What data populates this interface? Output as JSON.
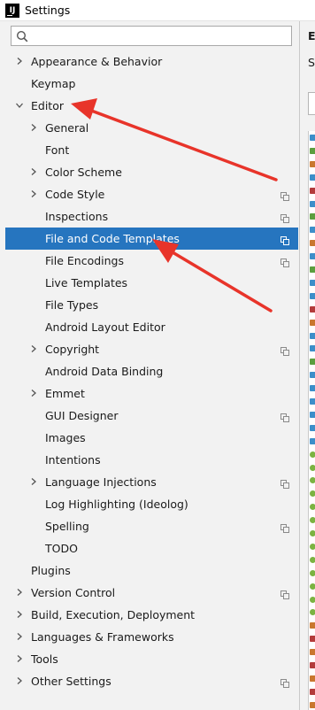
{
  "window": {
    "title": "Settings",
    "app_icon_text": "IJ"
  },
  "search": {
    "value": "",
    "placeholder": ""
  },
  "tree": [
    {
      "label": "Appearance & Behavior",
      "level": 0,
      "arrow": "right",
      "copy": false,
      "selected": false
    },
    {
      "label": "Keymap",
      "level": 0,
      "arrow": "none",
      "copy": false,
      "selected": false
    },
    {
      "label": "Editor",
      "level": 0,
      "arrow": "down",
      "copy": false,
      "selected": false
    },
    {
      "label": "General",
      "level": 1,
      "arrow": "right",
      "copy": false,
      "selected": false
    },
    {
      "label": "Font",
      "level": 1,
      "arrow": "none",
      "copy": false,
      "selected": false
    },
    {
      "label": "Color Scheme",
      "level": 1,
      "arrow": "right",
      "copy": false,
      "selected": false
    },
    {
      "label": "Code Style",
      "level": 1,
      "arrow": "right",
      "copy": true,
      "selected": false
    },
    {
      "label": "Inspections",
      "level": 1,
      "arrow": "none",
      "copy": true,
      "selected": false
    },
    {
      "label": "File and Code Templates",
      "level": 1,
      "arrow": "none",
      "copy": true,
      "selected": true
    },
    {
      "label": "File Encodings",
      "level": 1,
      "arrow": "none",
      "copy": true,
      "selected": false
    },
    {
      "label": "Live Templates",
      "level": 1,
      "arrow": "none",
      "copy": false,
      "selected": false
    },
    {
      "label": "File Types",
      "level": 1,
      "arrow": "none",
      "copy": false,
      "selected": false
    },
    {
      "label": "Android Layout Editor",
      "level": 1,
      "arrow": "none",
      "copy": false,
      "selected": false
    },
    {
      "label": "Copyright",
      "level": 1,
      "arrow": "right",
      "copy": true,
      "selected": false
    },
    {
      "label": "Android Data Binding",
      "level": 1,
      "arrow": "none",
      "copy": false,
      "selected": false
    },
    {
      "label": "Emmet",
      "level": 1,
      "arrow": "right",
      "copy": false,
      "selected": false
    },
    {
      "label": "GUI Designer",
      "level": 1,
      "arrow": "none",
      "copy": true,
      "selected": false
    },
    {
      "label": "Images",
      "level": 1,
      "arrow": "none",
      "copy": false,
      "selected": false
    },
    {
      "label": "Intentions",
      "level": 1,
      "arrow": "none",
      "copy": false,
      "selected": false
    },
    {
      "label": "Language Injections",
      "level": 1,
      "arrow": "right",
      "copy": true,
      "selected": false
    },
    {
      "label": "Log Highlighting (Ideolog)",
      "level": 1,
      "arrow": "none",
      "copy": false,
      "selected": false
    },
    {
      "label": "Spelling",
      "level": 1,
      "arrow": "none",
      "copy": true,
      "selected": false
    },
    {
      "label": "TODO",
      "level": 1,
      "arrow": "none",
      "copy": false,
      "selected": false
    },
    {
      "label": "Plugins",
      "level": 0,
      "arrow": "none",
      "copy": false,
      "selected": false
    },
    {
      "label": "Version Control",
      "level": 0,
      "arrow": "right",
      "copy": true,
      "selected": false
    },
    {
      "label": "Build, Execution, Deployment",
      "level": 0,
      "arrow": "right",
      "copy": false,
      "selected": false
    },
    {
      "label": "Languages & Frameworks",
      "level": 0,
      "arrow": "right",
      "copy": false,
      "selected": false
    },
    {
      "label": "Tools",
      "level": 0,
      "arrow": "right",
      "copy": false,
      "selected": false
    },
    {
      "label": "Other Settings",
      "level": 0,
      "arrow": "right",
      "copy": true,
      "selected": false
    }
  ],
  "right_pane": {
    "header_fragment": "E",
    "subheader_fragment": "S"
  },
  "colors": {
    "selection": "#2675bf",
    "annotation_arrow": "#e8342a",
    "icon_gray": "#8a8a8a"
  },
  "icons": {
    "search": "search-icon",
    "expand": "chevron-right-icon",
    "collapse": "chevron-down-icon",
    "project_scope": "copy-icon"
  }
}
